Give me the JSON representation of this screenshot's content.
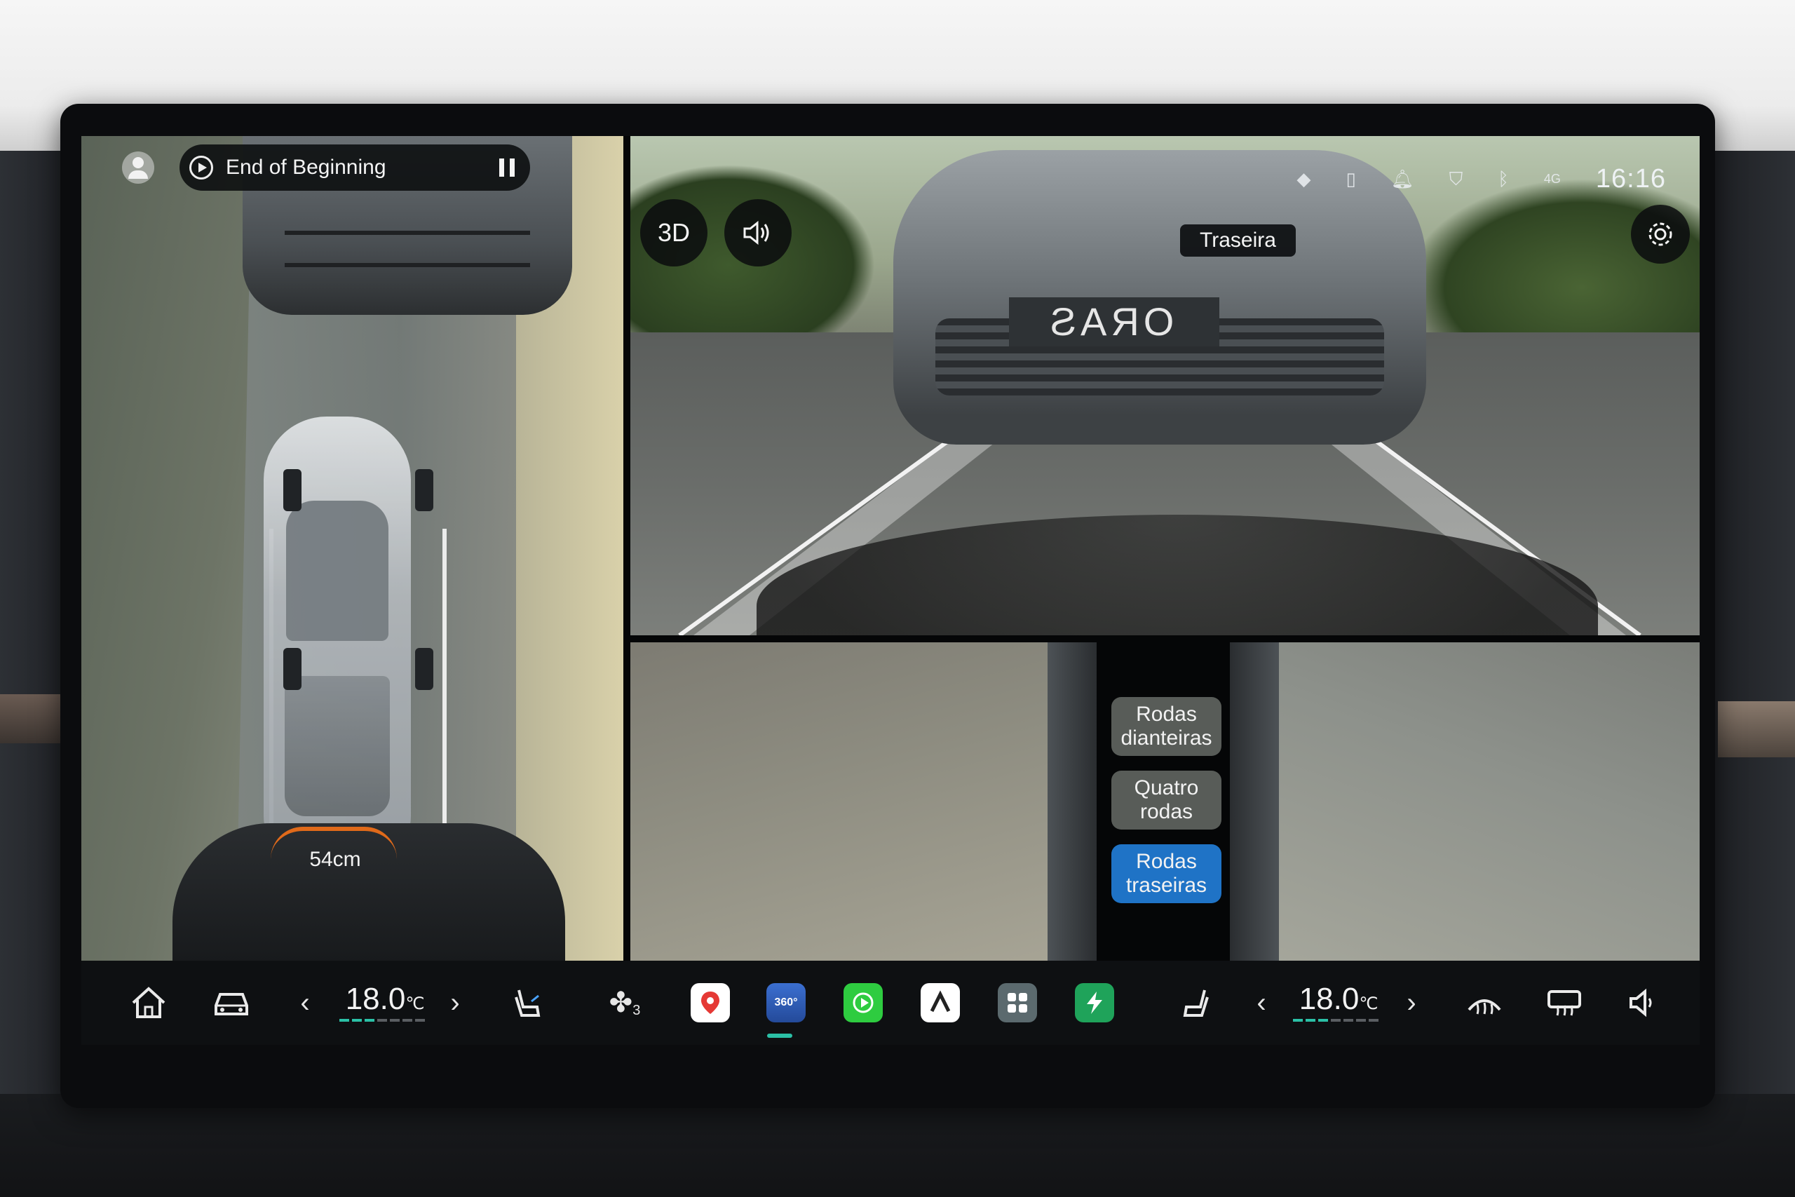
{
  "media": {
    "title": "End of Beginning"
  },
  "camera": {
    "view_label": "Traseira",
    "mode_3d_label": "3D",
    "distance_label": "54cm",
    "plate_text": "ƧAЯO",
    "modes": [
      {
        "label": "Rodas\ndianteiras",
        "active": false
      },
      {
        "label": "Quatro\nrodas",
        "active": false
      },
      {
        "label": "Rodas\ntraseiras",
        "active": true
      }
    ]
  },
  "status": {
    "time": "16:16",
    "network": "4G"
  },
  "climate": {
    "left_temp": "18.0",
    "right_temp": "18.0",
    "unit": "℃",
    "fan_speed": "3"
  },
  "dock": {
    "camera_app_label": "360°"
  },
  "colors": {
    "accent_blue": "#1f73c6",
    "orange_arc": "#e06a1a",
    "teal_indicator": "#2bc0a6"
  }
}
